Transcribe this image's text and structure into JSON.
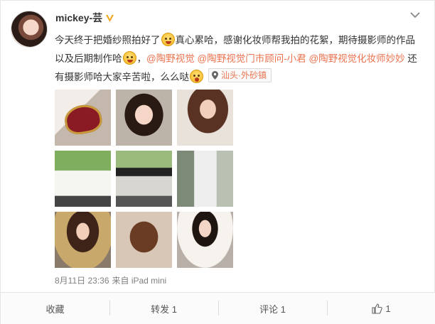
{
  "post": {
    "username": "mickey-芸",
    "verified_icon": "vip-v-icon",
    "text": {
      "part1": "今天终于把婚纱照拍好了",
      "part2": "真心累哈，感谢化妆师帮我拍的花絮，期待摄影师的作品以及后期制作哈",
      "part3": "，",
      "mention1": "@陶野视觉",
      "mention2": "@陶野视觉门市顾问-小君",
      "mention3": "@陶野视觉化妆师妙妙",
      "part4": " 还有摄影师哈大家辛苦啦，么么哒"
    },
    "location": "汕头·外砂镇",
    "photos": [
      "photo-1",
      "photo-2",
      "photo-3",
      "photo-4",
      "photo-5",
      "photo-6",
      "photo-7",
      "photo-8",
      "photo-9"
    ],
    "time": "8月11日 23:36",
    "source": "来自 iPad mini"
  },
  "actions": {
    "favorite": "收藏",
    "repost": "转发 1",
    "comment": "评论 1",
    "like": "1"
  },
  "colors": {
    "mention": "#eb7350",
    "verified": "#f2a51c"
  }
}
